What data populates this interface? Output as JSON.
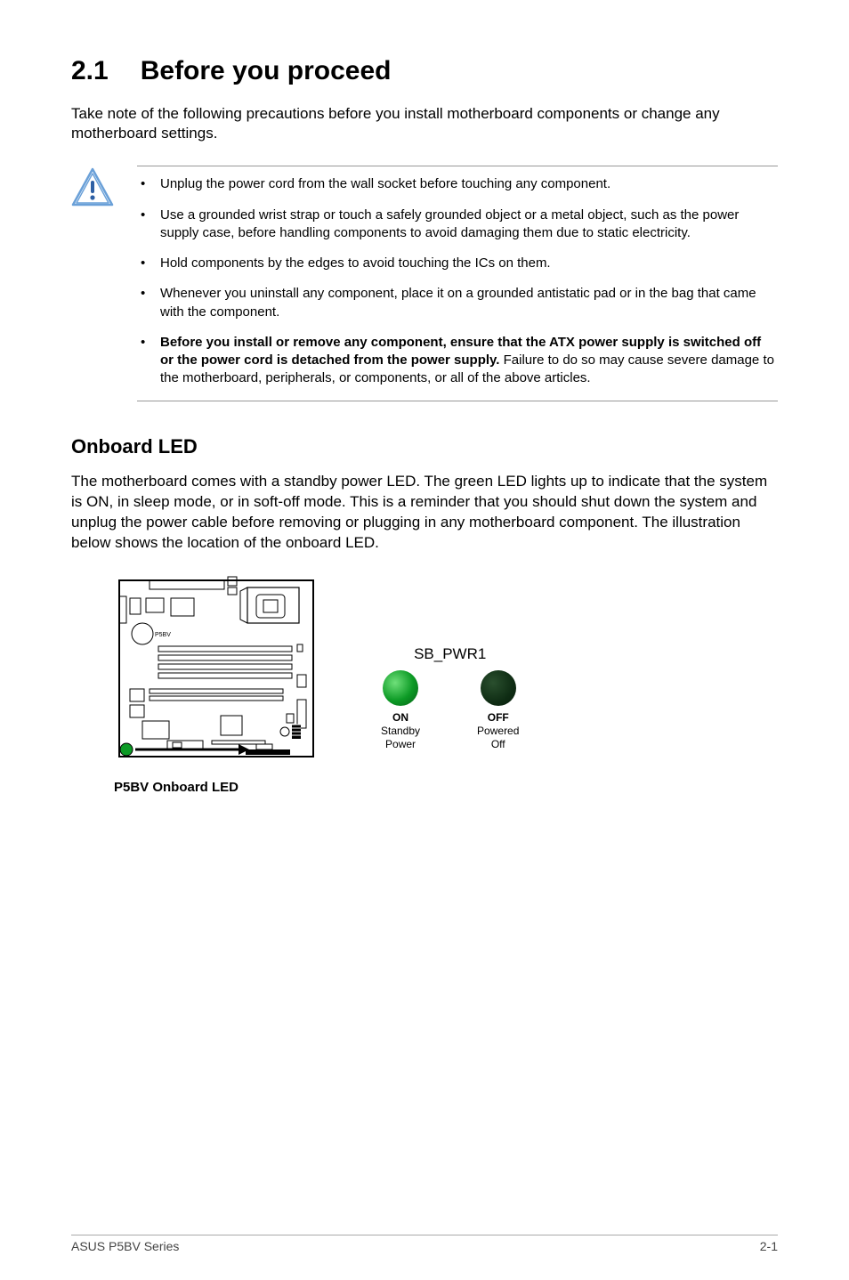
{
  "heading": {
    "number": "2.1",
    "title": "Before you proceed"
  },
  "intro": "Take note of the following precautions before you install motherboard components or change any motherboard settings.",
  "bullets": [
    {
      "text": "Unplug the power cord from the wall socket before touching any component."
    },
    {
      "text": "Use a grounded wrist strap or touch a safely grounded object or a metal object, such as the power supply case, before handling components to avoid damaging them due to static electricity."
    },
    {
      "text": "Hold components by the edges to avoid touching the ICs on them."
    },
    {
      "text": "Whenever you uninstall any component, place it on a grounded antistatic pad or in the bag that came with the component."
    },
    {
      "bold_prefix": "Before you install or remove any component, ensure that the ATX power supply is switched off or the power cord is detached from the power supply.",
      "rest": " Failure to do so may cause severe damage to the motherboard, peripherals, or components, or all of the above articles."
    }
  ],
  "onboard_led": {
    "heading": "Onboard LED",
    "paragraph": "The motherboard comes with a standby power LED. The green LED lights up to indicate that the system is ON, in sleep mode, or in soft-off mode. This is a reminder that you should shut down the system and unplug the power cable before removing or plugging in any motherboard component. The illustration below shows the location of the onboard LED.",
    "diagram": {
      "board_label": "P5BV",
      "caption": "P5BV Onboard LED",
      "legend_title": "SB_PWR1",
      "on": {
        "label": "ON",
        "sub": "Standby\nPower"
      },
      "off": {
        "label": "OFF",
        "sub": "Powered\nOff"
      }
    }
  },
  "footer": {
    "left": "ASUS P5BV Series",
    "right": "2-1"
  }
}
